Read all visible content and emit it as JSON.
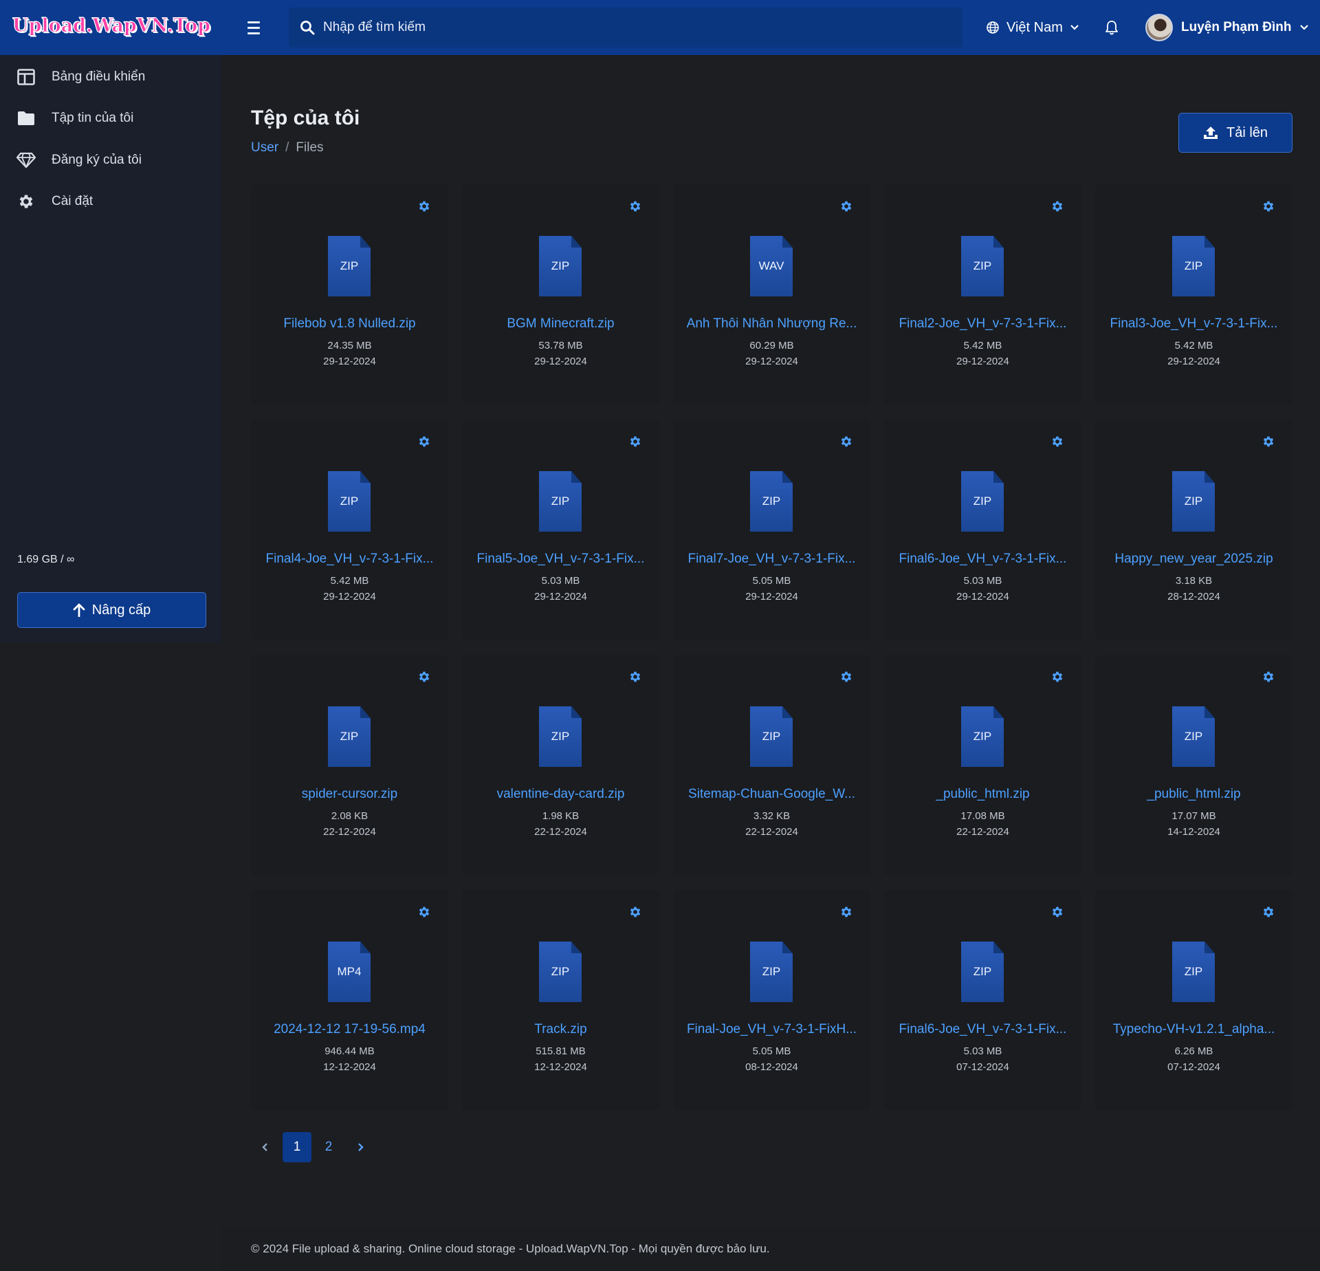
{
  "header": {
    "logo_text": "Upload.WapVN.Top",
    "search_placeholder": "Nhập để tìm kiếm",
    "language": "Việt Nam",
    "user_name": "Luyện Phạm Đình"
  },
  "sidebar": {
    "items": [
      {
        "label": "Bảng điều khiển",
        "icon": "dashboard-icon"
      },
      {
        "label": "Tập tin của tôi",
        "icon": "folder-icon"
      },
      {
        "label": "Đăng ký của tôi",
        "icon": "diamond-icon"
      },
      {
        "label": "Cài đặt",
        "icon": "gear-icon"
      }
    ],
    "quota": "1.69 GB / ∞",
    "upgrade_label": "Nâng cấp"
  },
  "main": {
    "title": "Tệp của tôi",
    "breadcrumb": {
      "root": "User",
      "separator": "/",
      "current": "Files"
    },
    "upload_label": "Tải lên"
  },
  "files": [
    {
      "ext": "ZIP",
      "name": "Filebob v1.8 Nulled.zip",
      "size": "24.35 MB",
      "date": "29-12-2024"
    },
    {
      "ext": "ZIP",
      "name": "BGM Minecraft.zip",
      "size": "53.78 MB",
      "date": "29-12-2024"
    },
    {
      "ext": "WAV",
      "name": "Anh Thôi Nhân Nhượng Re...",
      "size": "60.29 MB",
      "date": "29-12-2024"
    },
    {
      "ext": "ZIP",
      "name": "Final2-Joe_VH_v-7-3-1-Fix...",
      "size": "5.42 MB",
      "date": "29-12-2024"
    },
    {
      "ext": "ZIP",
      "name": "Final3-Joe_VH_v-7-3-1-Fix...",
      "size": "5.42 MB",
      "date": "29-12-2024"
    },
    {
      "ext": "ZIP",
      "name": "Final4-Joe_VH_v-7-3-1-Fix...",
      "size": "5.42 MB",
      "date": "29-12-2024"
    },
    {
      "ext": "ZIP",
      "name": "Final5-Joe_VH_v-7-3-1-Fix...",
      "size": "5.03 MB",
      "date": "29-12-2024"
    },
    {
      "ext": "ZIP",
      "name": "Final7-Joe_VH_v-7-3-1-Fix...",
      "size": "5.05 MB",
      "date": "29-12-2024"
    },
    {
      "ext": "ZIP",
      "name": "Final6-Joe_VH_v-7-3-1-Fix...",
      "size": "5.03 MB",
      "date": "29-12-2024"
    },
    {
      "ext": "ZIP",
      "name": "Happy_new_year_2025.zip",
      "size": "3.18 KB",
      "date": "28-12-2024"
    },
    {
      "ext": "ZIP",
      "name": "spider-cursor.zip",
      "size": "2.08 KB",
      "date": "22-12-2024"
    },
    {
      "ext": "ZIP",
      "name": "valentine-day-card.zip",
      "size": "1.98 KB",
      "date": "22-12-2024"
    },
    {
      "ext": "ZIP",
      "name": "Sitemap-Chuan-Google_W...",
      "size": "3.32 KB",
      "date": "22-12-2024"
    },
    {
      "ext": "ZIP",
      "name": "_public_html.zip",
      "size": "17.08 MB",
      "date": "22-12-2024"
    },
    {
      "ext": "ZIP",
      "name": "_public_html.zip",
      "size": "17.07 MB",
      "date": "14-12-2024"
    },
    {
      "ext": "MP4",
      "name": "2024-12-12 17-19-56.mp4",
      "size": "946.44 MB",
      "date": "12-12-2024"
    },
    {
      "ext": "ZIP",
      "name": "Track.zip",
      "size": "515.81 MB",
      "date": "12-12-2024"
    },
    {
      "ext": "ZIP",
      "name": "Final-Joe_VH_v-7-3-1-FixH...",
      "size": "5.05 MB",
      "date": "08-12-2024"
    },
    {
      "ext": "ZIP",
      "name": "Final6-Joe_VH_v-7-3-1-Fix...",
      "size": "5.03 MB",
      "date": "07-12-2024"
    },
    {
      "ext": "ZIP",
      "name": "Typecho-VH-v1.2.1_alpha...",
      "size": "6.26 MB",
      "date": "07-12-2024"
    }
  ],
  "pagination": {
    "prev": "‹",
    "pages": [
      "1",
      "2"
    ],
    "current": "1",
    "next": "›"
  },
  "footer": {
    "text": "© 2024 File upload & sharing. Online cloud storage - Upload.WapVN.Top - Mọi quyền được bảo lưu."
  },
  "colors": {
    "topbar": "#0b3a8e",
    "accent": "#4da0ff",
    "background": "#1c1e21",
    "sidebar": "#1b1f2b",
    "card": "#1a1c20"
  }
}
